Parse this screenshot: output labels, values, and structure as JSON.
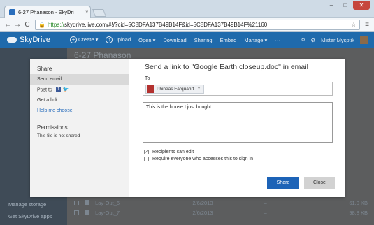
{
  "browser": {
    "tab_title": "6-27 Phanason - SkyDri",
    "tab_close": "×",
    "url_scheme": "https://",
    "url_rest": "skydrive.live.com/#!/?cid=5C8DFA137B49B14F&id=5C8DFA137B49B14F%21160",
    "back": "←",
    "forward": "→",
    "reload": "C",
    "star": "☆",
    "menu": "≡",
    "minimize": "–",
    "maximize": "□",
    "close": "✕"
  },
  "appbar": {
    "brand": "SkyDrive",
    "commands": [
      "Create",
      "Upload",
      "Open",
      "Download",
      "Sharing",
      "Embed",
      "Manage"
    ],
    "more": "···",
    "user": "Mister Mysptik"
  },
  "background": {
    "folder_title": "6-27 Phanason",
    "bottom_links": [
      "Manage storage",
      "Get SkyDrive apps"
    ],
    "rows": [
      {
        "name": "Lay-Out_6",
        "date": "2/6/2013",
        "dash": "–",
        "size": "61.0 KB"
      },
      {
        "name": "Lay-Out_7",
        "date": "2/6/2013",
        "dash": "–",
        "size": "98.8 KB"
      }
    ]
  },
  "dialog": {
    "title": "Send a link to \"Google Earth closeup.doc\" in email",
    "side": {
      "share_heading": "Share",
      "send_email": "Send email",
      "post_to": "Post to",
      "facebook": "f",
      "twitter": "🐦",
      "get_link": "Get a link",
      "help": "Help me choose",
      "permissions_heading": "Permissions",
      "permissions_text": "This file is not shared"
    },
    "to_label": "To",
    "recipient": "Phineas Farquahrt",
    "recipient_remove": "×",
    "message": "This is the house I just bought.",
    "option_edit": "Recipients can edit",
    "option_edit_checked": true,
    "option_signin": "Require everyone who accesses this to sign in",
    "option_signin_checked": false,
    "share_button": "Share",
    "close_button": "Close"
  }
}
